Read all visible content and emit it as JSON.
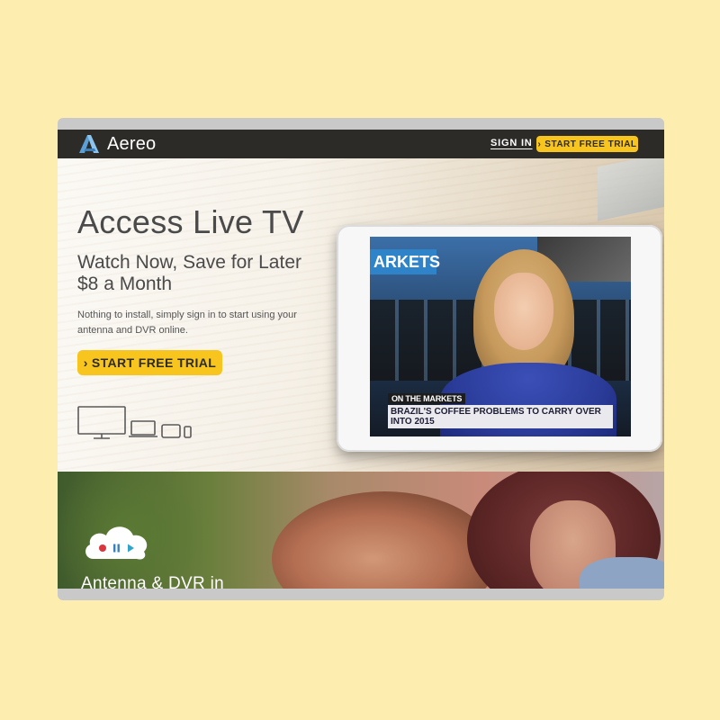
{
  "nav": {
    "brand": "Aereo",
    "sign_in": "SIGN IN",
    "trial_button": "START FREE TRIAL"
  },
  "hero": {
    "title": "Access Live TV",
    "subtitle_line1": "Watch Now, Save for Later",
    "subtitle_line2": "$8 a Month",
    "description": "Nothing to install, simply sign in to start using your antenna and DVR online.",
    "cta": "START FREE TRIAL",
    "devices": [
      "tv-icon",
      "laptop-icon",
      "tablet-icon",
      "phone-icon"
    ]
  },
  "tablet_screen": {
    "wall_text": "ARKETS",
    "ticker_label": "ON THE MARKETS",
    "ticker_text": "BRAZIL'S COFFEE PROBLEMS TO CARRY OVER INTO 2015"
  },
  "lower_section": {
    "heading": "Antenna & DVR in",
    "cloud_icons": [
      "record-icon",
      "pause-icon",
      "play-icon"
    ]
  },
  "colors": {
    "page_bg": "#fdeeb0",
    "nav_bg": "#2d2b28",
    "accent": "#f7c51d",
    "logo_blue": "#5aa0d6"
  }
}
